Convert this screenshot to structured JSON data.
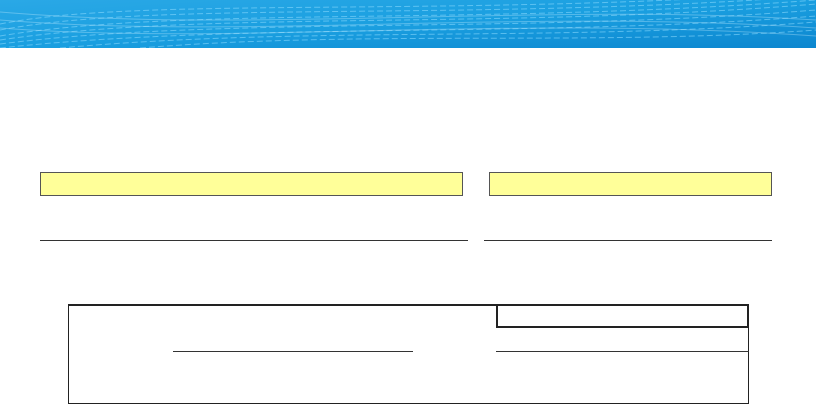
{
  "header": {
    "banner_colors": {
      "base": "#1a9fe0",
      "light": "#6fd0f7",
      "dark": "#0b7fc4"
    }
  },
  "form": {
    "field_left": {
      "value": "",
      "placeholder": ""
    },
    "field_right": {
      "value": "",
      "placeholder": ""
    },
    "line_left": "",
    "line_right": "",
    "signature_box": {
      "line_left": "",
      "line_right": "",
      "top_right_field": {
        "value": ""
      }
    }
  }
}
